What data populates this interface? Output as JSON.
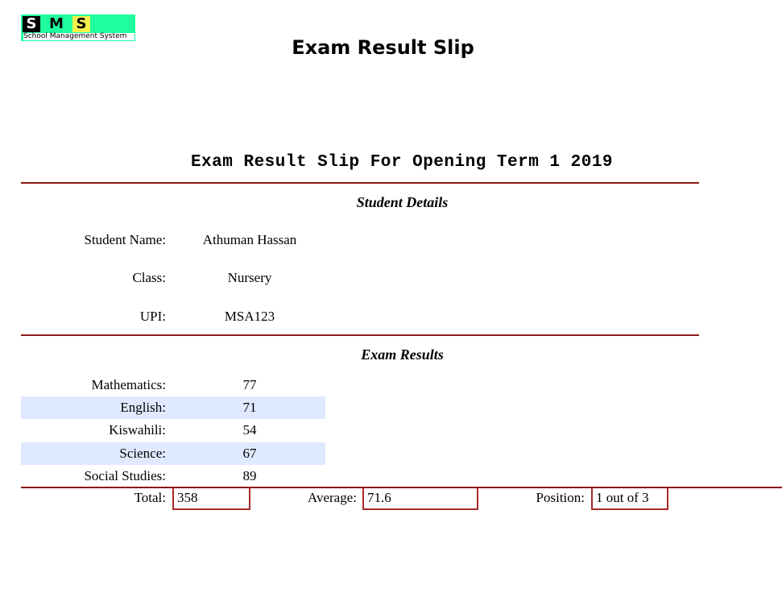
{
  "logo": {
    "letters": [
      "S",
      "M",
      "S"
    ],
    "subtitle": "School Management System"
  },
  "page_title": "Exam Result Slip",
  "slip_heading": "Exam Result Slip For Opening Term 1 2019",
  "student_details": {
    "title": "Student Details",
    "name_label": "Student Name:",
    "name_value": "Athuman Hassan",
    "class_label": "Class:",
    "class_value": "Nursery",
    "upi_label": "UPI:",
    "upi_value": "MSA123"
  },
  "exam_results": {
    "title": "Exam Results",
    "subjects": [
      {
        "label": "Mathematics:",
        "score": "77"
      },
      {
        "label": "English:",
        "score": "71"
      },
      {
        "label": "Kiswahili:",
        "score": "54"
      },
      {
        "label": "Science:",
        "score": "67"
      },
      {
        "label": "Social Studies:",
        "score": "89"
      }
    ]
  },
  "summary": {
    "total_label": "Total:",
    "total_value": "358",
    "average_label": "Average:",
    "average_value": "71.6",
    "position_label": "Position:",
    "position_value": "1 out of 3"
  },
  "colors": {
    "rule": "#8b1a1a",
    "stripe": "#dfe9ff",
    "logo_green": "#20ff9f",
    "logo_yellow": "#f5ef4a"
  }
}
